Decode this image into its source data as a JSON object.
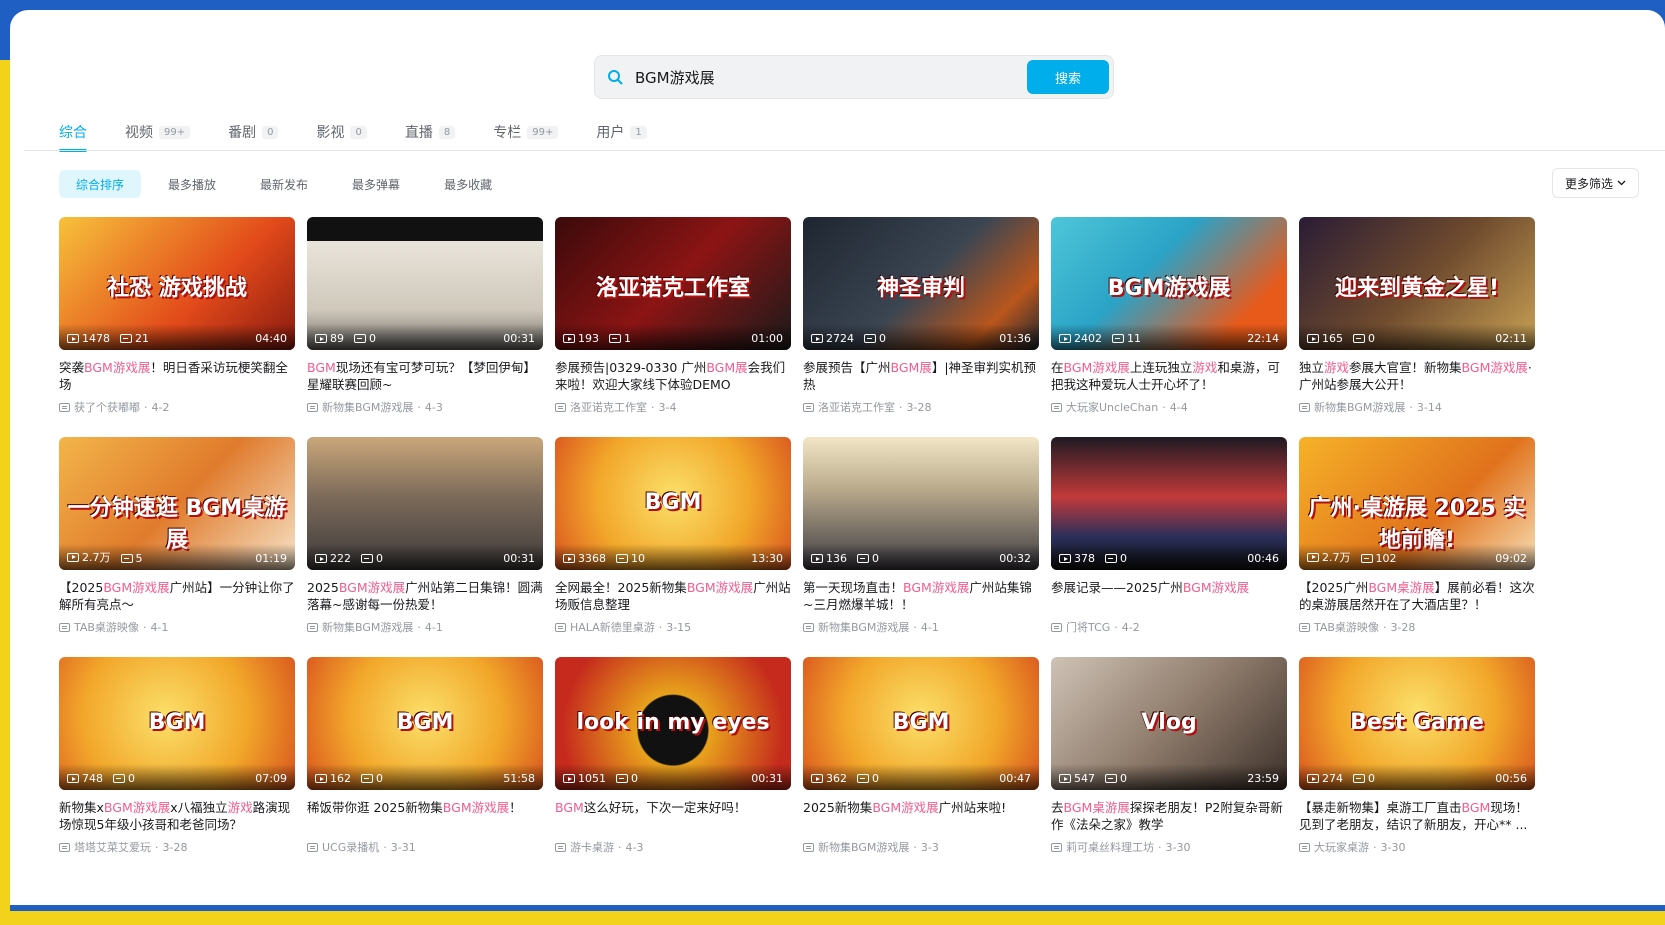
{
  "search": {
    "value": "BGM游戏展",
    "button": "搜索"
  },
  "tabs": [
    {
      "label": "综合",
      "count": ""
    },
    {
      "label": "视频",
      "count": "99+"
    },
    {
      "label": "番剧",
      "count": "0"
    },
    {
      "label": "影视",
      "count": "0"
    },
    {
      "label": "直播",
      "count": "8"
    },
    {
      "label": "专栏",
      "count": "99+"
    },
    {
      "label": "用户",
      "count": "1"
    }
  ],
  "sort": [
    "综合排序",
    "最多播放",
    "最新发布",
    "最多弹幕",
    "最多收藏"
  ],
  "filter": {
    "label": "更多筛选",
    "icon": "chevron-down-icon"
  },
  "colors": {
    "accent": "#00aeec",
    "highlight": "#f25d8e"
  },
  "videos": [
    {
      "thumb_text": "社恐 游戏挑战",
      "bg": "linear-gradient(135deg,#f7c23b,#e24a1a 60%,#8a1a10)",
      "plays": "1478",
      "danmaku": "21",
      "duration": "04:40",
      "title": "突袭BGM游戏展！明日香采访玩梗笑翻全场",
      "author": "获了个获嘟嘟",
      "date": "4-2"
    },
    {
      "thumb_text": "",
      "bg": "linear-gradient(180deg,#111 0 18%,#e9e4da 18%,#cfc8bb 70%,#6d6a66)",
      "plays": "89",
      "danmaku": "0",
      "duration": "00:31",
      "title": "BGM现场还有宝可梦可玩？【梦回伊甸】星耀联赛回顾~",
      "author": "新物集BGM游戏展",
      "date": "4-3"
    },
    {
      "thumb_text": "洛亚诺克工作室",
      "bg": "linear-gradient(135deg,#3a0a0a,#8c1414 50%,#1a1a1a)",
      "plays": "193",
      "danmaku": "1",
      "duration": "01:00",
      "title": "参展预告|0329-0330 广州BGM展会我们来啦！欢迎大家线下体验DEMO",
      "author": "洛亚诺克工作室",
      "date": "3-4"
    },
    {
      "thumb_text": "神圣审判",
      "bg": "linear-gradient(135deg,#1d2630,#3b4552 50%,#b9561c 80%,#1d2630)",
      "plays": "2724",
      "danmaku": "0",
      "duration": "01:36",
      "title": "参展预告【广州BGM展】|神圣审判实机预热",
      "author": "洛亚诺克工作室",
      "date": "3-28"
    },
    {
      "thumb_text": "BGM游戏展",
      "bg": "linear-gradient(135deg,#4ec6d8,#2aa3c7 40%,#e85a1a 80%)",
      "plays": "2402",
      "danmaku": "11",
      "duration": "22:14",
      "title": "在BGM游戏展上连玩独立游戏和桌游，可把我这种爱玩人士开心坏了！",
      "author": "大玩家UncleChan",
      "date": "4-4"
    },
    {
      "thumb_text": "迎来到黄金之星!",
      "bg": "linear-gradient(135deg,#2a1c35,#6e4a2e 50%,#c9a254)",
      "plays": "165",
      "danmaku": "0",
      "duration": "02:11",
      "title": "独立游戏参展大官宣！新物集BGM游戏展·广州站参展大公开！",
      "author": "新物集BGM游戏展",
      "date": "3-14"
    },
    {
      "thumb_text": "一分钟速逛 BGM桌游展",
      "bg": "linear-gradient(135deg,#f3b54a,#e07b2c 50%,#f6e3c8)",
      "plays": "2.7万",
      "danmaku": "5",
      "duration": "01:19",
      "title": "【2025BGM游戏展广州站】一分钟让你了解所有亮点～",
      "author": "TAB桌游映像",
      "date": "4-1"
    },
    {
      "thumb_text": "",
      "bg": "linear-gradient(180deg,#caa77a,#7c6a5a 45%,#3d3a3a)",
      "plays": "222",
      "danmaku": "0",
      "duration": "00:31",
      "title": "2025BGM游戏展广州站第二日集锦！圆满落幕~感谢每一份热爱！",
      "author": "新物集BGM游戏展",
      "date": "4-1"
    },
    {
      "thumb_text": "BGM",
      "bg": "radial-gradient(circle at 50% 45%,#fbe06a,#f2a72a 55%,#d9531e)",
      "plays": "3368",
      "danmaku": "10",
      "duration": "13:30",
      "title": "全网最全！2025新物集BGM游戏展广州站场贩信息整理",
      "author": "HALA新德里桌游",
      "date": "3-15"
    },
    {
      "thumb_text": "",
      "bg": "linear-gradient(180deg,#f1e6c6,#b8a98b 40%,#3c3a42)",
      "plays": "136",
      "danmaku": "0",
      "duration": "00:32",
      "title": "第一天现场直击！BGM游戏展广州站集锦~三月燃爆羊城！！",
      "author": "新物集BGM游戏展",
      "date": "4-1"
    },
    {
      "thumb_text": "",
      "bg": "linear-gradient(180deg,#1e1a22,#c23a3a 45%,#2b2f5a 75%,#111)",
      "plays": "378",
      "danmaku": "0",
      "duration": "00:46",
      "title": "参展记录——2025广州BGM游戏展",
      "author": "门将TCG",
      "date": "4-2"
    },
    {
      "thumb_text": "广州·桌游展 2025 实地前瞻!",
      "bg": "linear-gradient(135deg,#f6b228,#e0721c 60%,#f8e0b8)",
      "plays": "2.7万",
      "danmaku": "102",
      "duration": "09:02",
      "title": "【2025广州BGM桌游展】展前必看！这次的桌游展居然开在了大酒店里？！",
      "author": "TAB桌游映像",
      "date": "3-28"
    },
    {
      "thumb_text": "BGM",
      "bg": "radial-gradient(circle at 45% 45%,#fbe06a,#f2a72a 55%,#d9531e)",
      "plays": "748",
      "danmaku": "0",
      "duration": "07:09",
      "title": "新物集xBGM游戏展x八福独立游戏路演现场惊现5年级小孩哥和老爸同场？",
      "author": "塔塔艾菜艾爱玩",
      "date": "3-28"
    },
    {
      "thumb_text": "BGM",
      "bg": "radial-gradient(circle at 50% 45%,#fbe06a,#f2a72a 55%,#d9531e)",
      "plays": "162",
      "danmaku": "0",
      "duration": "51:58",
      "title": "稀饭带你逛 2025新物集BGM游戏展！",
      "author": "UCG录播机",
      "date": "3-31"
    },
    {
      "thumb_text": "look in my eyes",
      "bg": "radial-gradient(circle at 50% 55%,#111 0 25%,#e8a21c 26%,#c52a1c 80%)",
      "plays": "1051",
      "danmaku": "0",
      "duration": "00:31",
      "title": "BGM这么好玩，下次一定来好吗！",
      "author": "游卡桌游",
      "date": "4-3"
    },
    {
      "thumb_text": "BGM",
      "bg": "radial-gradient(circle at 50% 45%,#fbe06a,#f2a72a 55%,#d9531e)",
      "plays": "362",
      "danmaku": "0",
      "duration": "00:47",
      "title": "2025新物集BGM游戏展广州站来啦!",
      "author": "新物集BGM游戏展",
      "date": "3-3"
    },
    {
      "thumb_text": "Vlog",
      "bg": "linear-gradient(135deg,#cfc3b6,#8f7c6c 50%,#3c302a)",
      "plays": "547",
      "danmaku": "0",
      "duration": "23:59",
      "title": "去BGM桌游展探探老朋友！P2附复杂哥新作《法朵之家》教学",
      "author": "莉可桌丝料理工坊",
      "date": "3-30"
    },
    {
      "thumb_text": "Best Game",
      "bg": "radial-gradient(circle at 50% 40%,#fbe06a,#f2a72a 55%,#d9531e)",
      "plays": "274",
      "danmaku": "0",
      "duration": "00:56",
      "title": "【暴走新物集】桌游工厂直击BGM现场！见到了老朋友，结识了新朋友，开心** ...",
      "author": "大玩家桌游",
      "date": "3-30"
    }
  ]
}
